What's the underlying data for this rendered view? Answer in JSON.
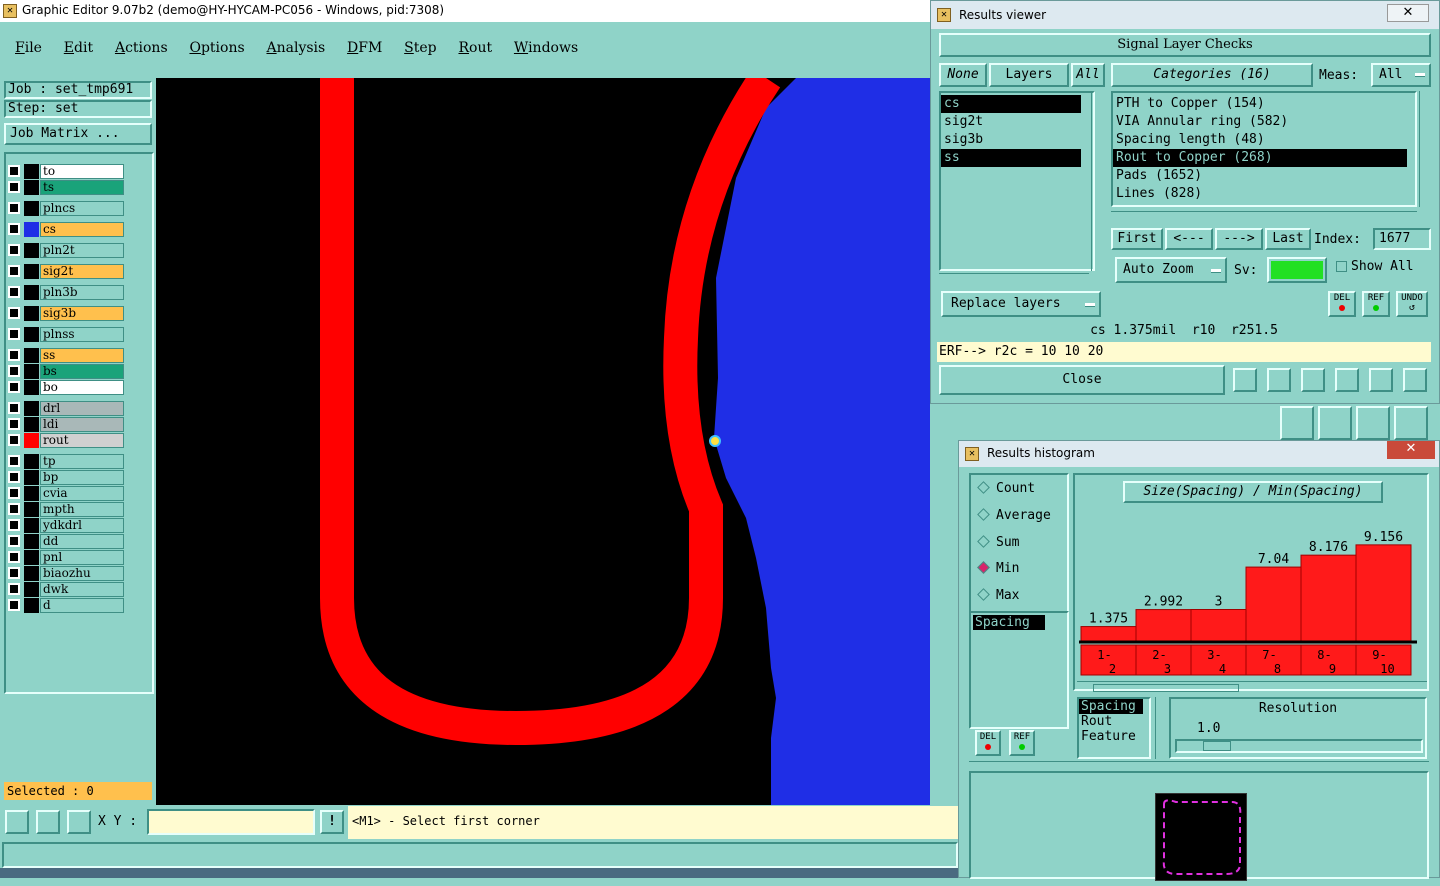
{
  "main": {
    "title": "Graphic Editor 9.07b2 (demo@HY-HYCAM-PC056 - Windows, pid:7308)",
    "menu": [
      "File",
      "Edit",
      "Actions",
      "Options",
      "Analysis",
      "DFM",
      "Step",
      "Rout",
      "Windows"
    ],
    "job_label": "Job : set_tmp691",
    "step_label": "Step: set",
    "job_matrix": "Job Matrix ...",
    "layers": [
      {
        "name": "to",
        "color": "#ffffff"
      },
      {
        "name": "ts",
        "color": "#1aa37a"
      },
      {
        "name": "plncs",
        "color": "#8fd3c8"
      },
      {
        "name": "cs",
        "color": "#ffc04d"
      },
      {
        "name": "pln2t",
        "color": "#8fd3c8"
      },
      {
        "name": "sig2t",
        "color": "#ffc04d"
      },
      {
        "name": "pln3b",
        "color": "#8fd3c8"
      },
      {
        "name": "sig3b",
        "color": "#ffc04d"
      },
      {
        "name": "plnss",
        "color": "#8fd3c8"
      },
      {
        "name": "ss",
        "color": "#ffc04d"
      },
      {
        "name": "bs",
        "color": "#1aa37a"
      },
      {
        "name": "bo",
        "color": "#ffffff"
      },
      {
        "name": "drl",
        "color": "#a9b8b8"
      },
      {
        "name": "ldi",
        "color": "#a9b8b8"
      },
      {
        "name": "rout",
        "color": "#d0d0d0"
      },
      {
        "name": "tp",
        "color": "#8fd3c8"
      },
      {
        "name": "bp",
        "color": "#8fd3c8"
      },
      {
        "name": "cvia",
        "color": "#8fd3c8"
      },
      {
        "name": "mpth",
        "color": "#8fd3c8"
      },
      {
        "name": "ydkdrl",
        "color": "#8fd3c8"
      },
      {
        "name": "dd",
        "color": "#8fd3c8"
      },
      {
        "name": "pnl",
        "color": "#8fd3c8"
      },
      {
        "name": "biaozhu",
        "color": "#8fd3c8"
      },
      {
        "name": "dwk",
        "color": "#8fd3c8"
      },
      {
        "name": "d",
        "color": "#8fd3c8"
      }
    ],
    "selected": "Selected : 0",
    "xy_label": "X Y :",
    "xy_value": "",
    "status_msg": "<M1> - Select first corner"
  },
  "results_viewer": {
    "title": "Results viewer",
    "header": "Signal Layer Checks",
    "none_btn": "None",
    "layers_btn": "Layers",
    "all_btn": "All",
    "layer_list": [
      "cs",
      "sig2t",
      "sig3b",
      "ss"
    ],
    "categories_btn": "Categories (16)",
    "meas_label": "Meas:",
    "meas_value": "All",
    "categories": [
      "PTH to Copper (154)",
      "VIA Annular ring (582)",
      "Spacing length (48)",
      "Rout to Copper (268)",
      "Pads (1652)",
      "Lines (828)"
    ],
    "first_btn": "First",
    "prev_btn": "<---",
    "next_btn": "--->",
    "last_btn": "Last",
    "index_label": "Index:",
    "index_value": "1677",
    "auto_zoom": "Auto Zoom",
    "sv_label": "Sv:",
    "sv_color": "#22e022",
    "show_all": "Show All",
    "replace_layers": "Replace layers",
    "del": "DEL",
    "ref": "REF",
    "undo": "UNDO",
    "info_line": "cs 1.375mil  r10  r251.5",
    "erf_line": "ERF--> r2c = 10 10 20",
    "close": "Close"
  },
  "histogram": {
    "title": "Results histogram",
    "modes": [
      "Count",
      "Average",
      "Sum",
      "Min",
      "Max"
    ],
    "selected_mode": "Min",
    "list_item": "Spacing",
    "del": "DEL",
    "ref": "REF",
    "chart_title": "Size(Spacing) / Min(Spacing)",
    "opts": [
      "Spacing",
      "Rout",
      "Feature"
    ],
    "resolution_label": "Resolution",
    "resolution_value": "1.0"
  },
  "chart_data": {
    "type": "bar",
    "title": "Size(Spacing) / Min(Spacing)",
    "categories": [
      "1-2",
      "2-3",
      "3-4",
      "7-8",
      "8-9",
      "9-10"
    ],
    "values": [
      1.375,
      2.992,
      3,
      7.04,
      8.176,
      9.156
    ],
    "ylim": [
      0,
      10
    ],
    "grid": false
  },
  "colors": {
    "panel": "#8fd3c8",
    "canvas": "#000000",
    "copper": "#1f2ee6",
    "rout": "#ff0000",
    "status": "#fffbd0"
  }
}
